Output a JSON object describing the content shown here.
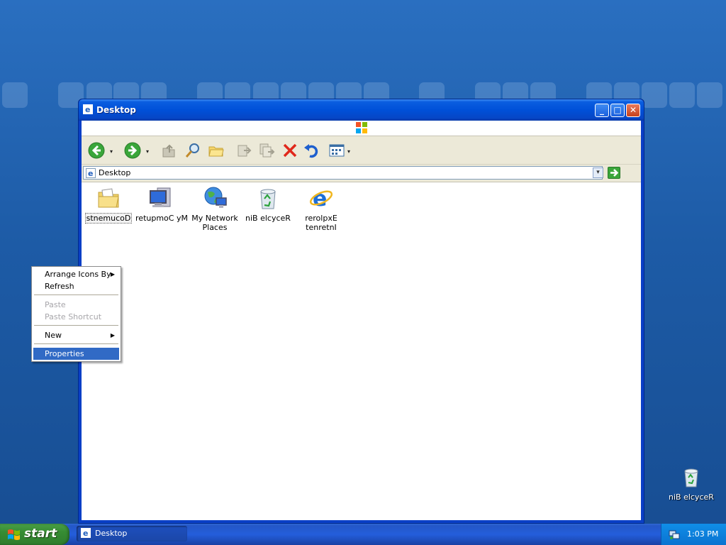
{
  "window": {
    "title": "Desktop",
    "buttons": {
      "minimize": "_",
      "maximize": "□",
      "close": "✕"
    }
  },
  "toolbar": {
    "tools": [
      "back-icon",
      "forward-icon",
      "up-folder-icon",
      "search-icon",
      "folders-icon",
      "move-to-icon",
      "copy-to-icon",
      "delete-icon",
      "undo-icon",
      "views-icon"
    ],
    "dropdown_glyph": "▾"
  },
  "address": {
    "value": "Desktop",
    "dropdown_glyph": "▾"
  },
  "files": [
    {
      "label": "stnemucoD",
      "icon": "folder-documents-icon"
    },
    {
      "label": "retupmoC yM",
      "icon": "my-computer-icon"
    },
    {
      "label": "My Network Places",
      "icon": "network-places-icon"
    },
    {
      "label": "niB elcyceR",
      "icon": "recycle-bin-icon"
    },
    {
      "label": "rerolpxE tenretnI",
      "icon": "internet-explorer-icon"
    }
  ],
  "context_menu": {
    "items": [
      {
        "label": "Arrange Icons By",
        "submenu": "▶"
      },
      {
        "label": "Refresh"
      },
      {
        "label": "Paste",
        "disabled": true
      },
      {
        "label": "Paste Shortcut",
        "disabled": true
      },
      {
        "label": "New",
        "submenu": "▶"
      },
      {
        "label": "Properties",
        "highlighted": true
      }
    ]
  },
  "desktop_icon": {
    "label": "niB elcyceR"
  },
  "taskbar": {
    "start_label": "start",
    "task": "Desktop",
    "clock": "1:03 PM"
  },
  "colors": {
    "highlight": "#316ac5",
    "title_blue": "#0050d8",
    "start_green": "#368c33"
  }
}
